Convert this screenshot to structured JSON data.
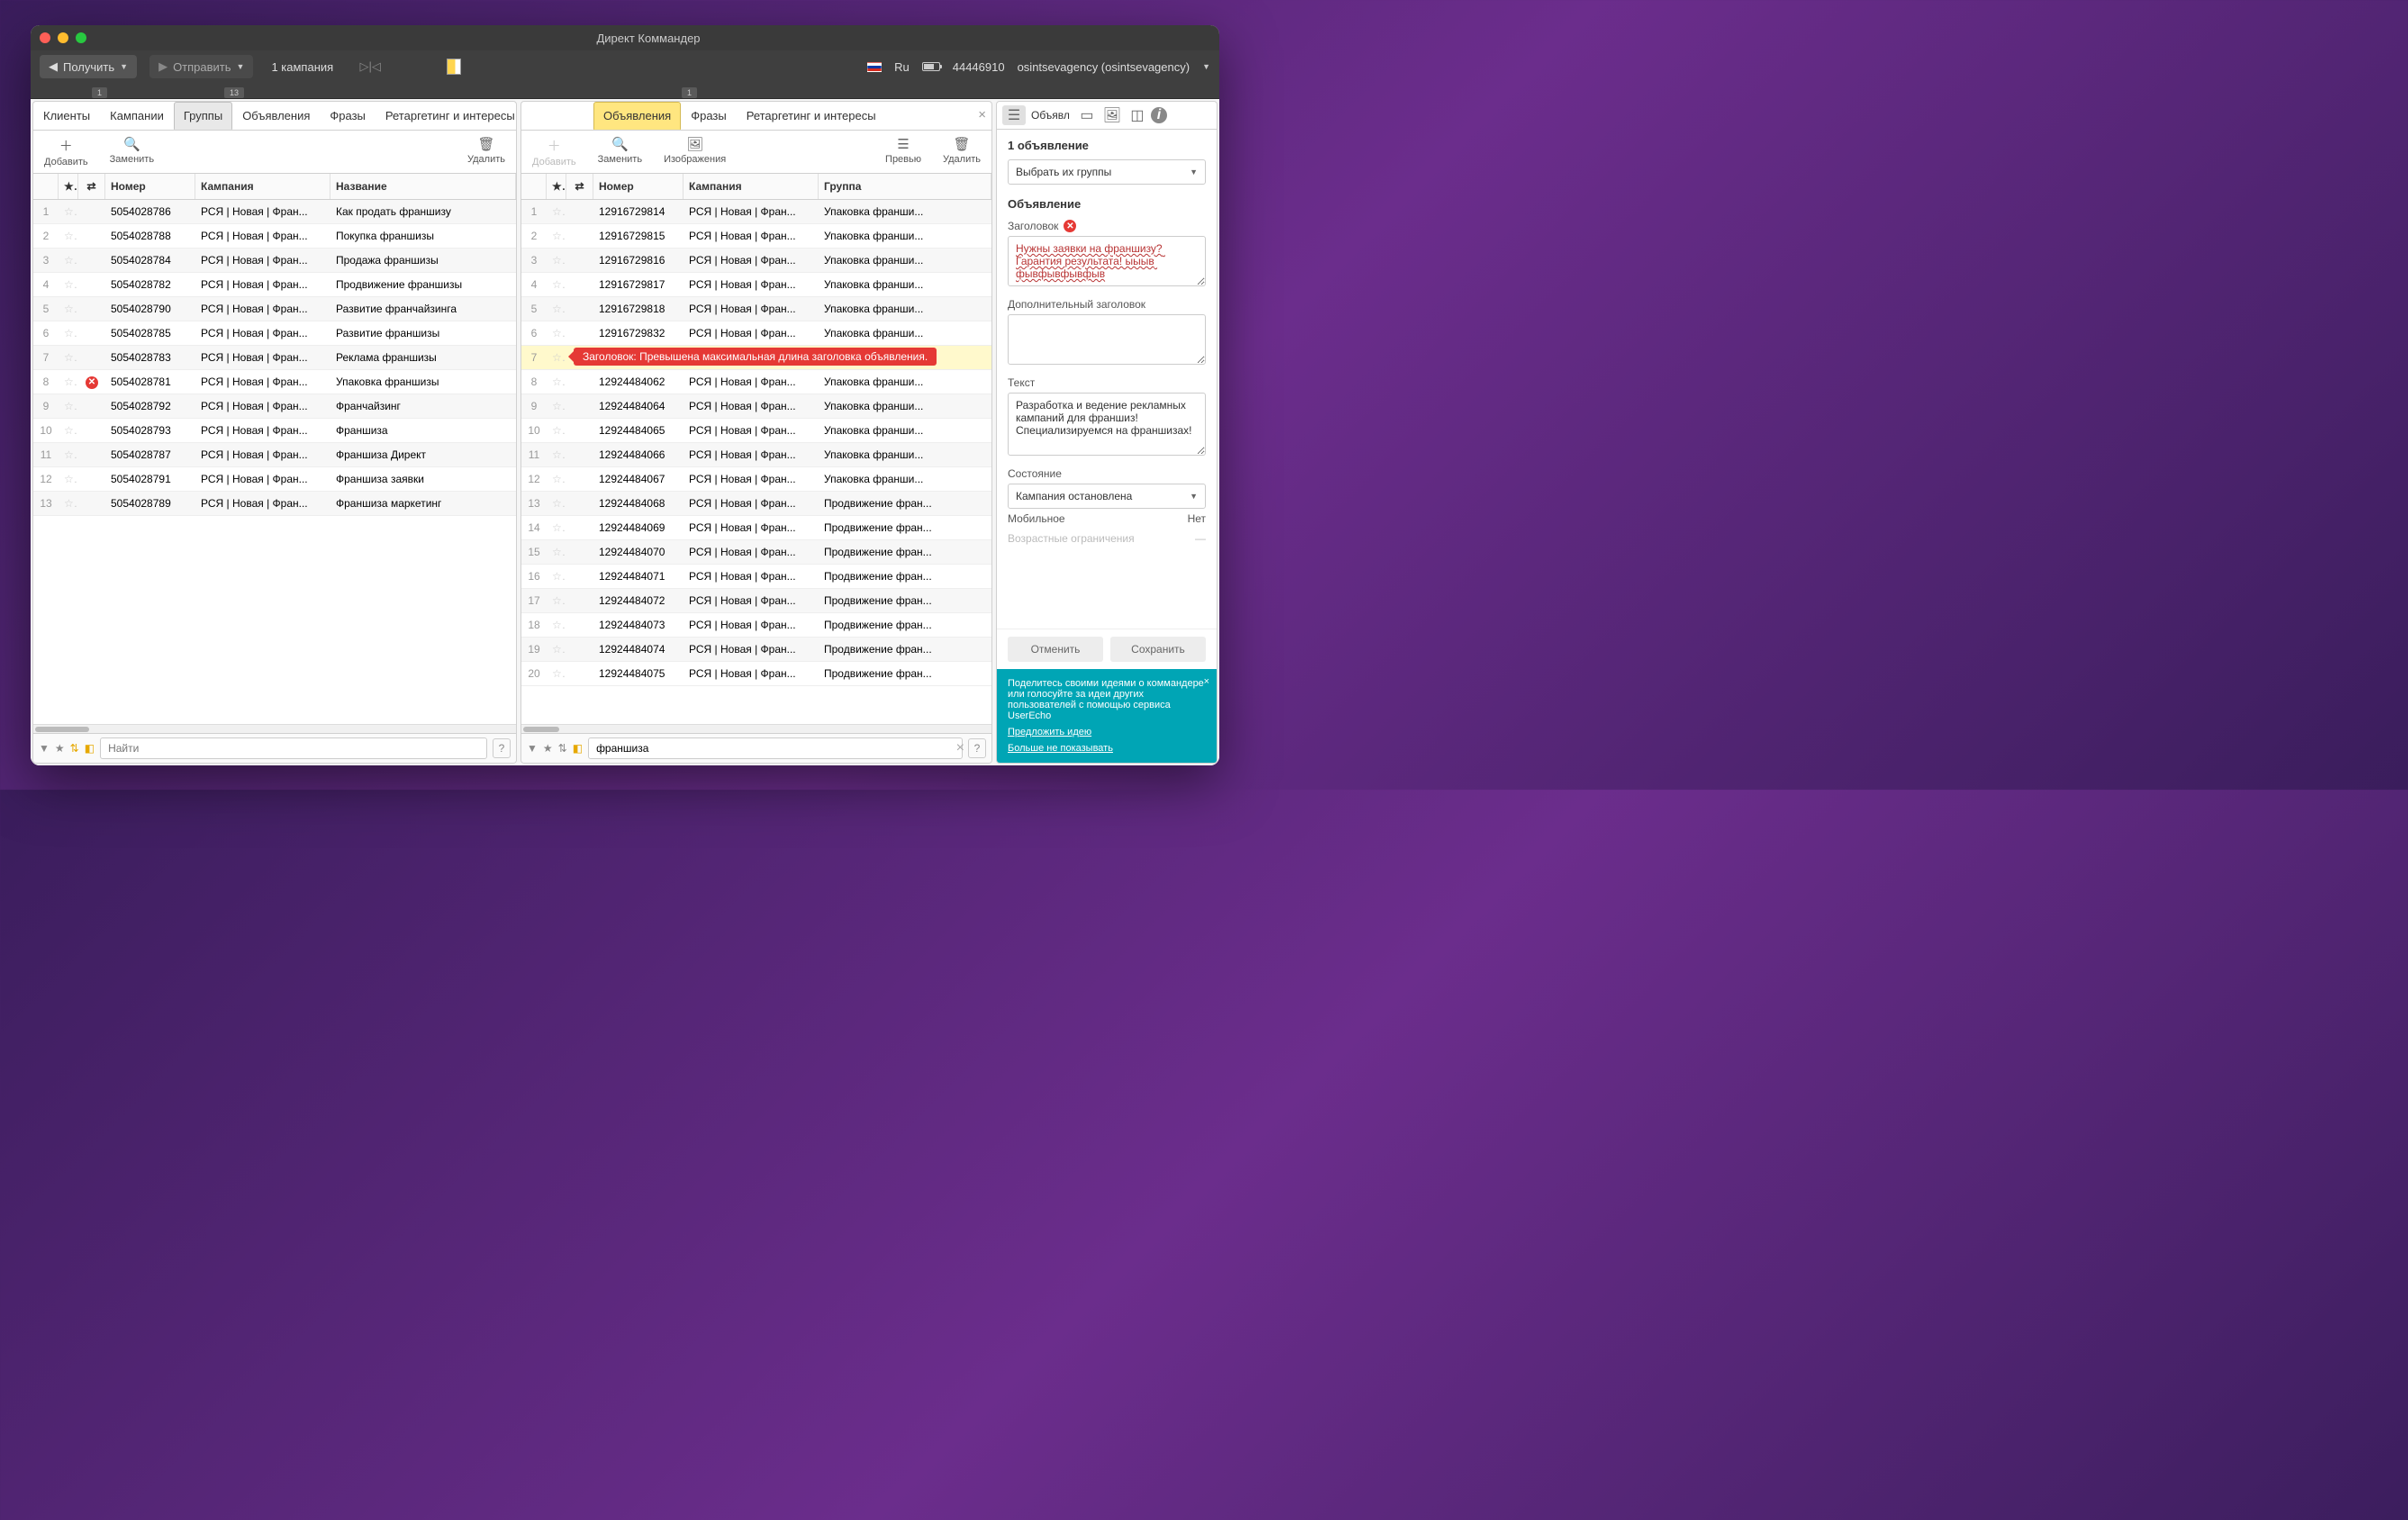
{
  "window": {
    "title": "Директ Коммандер"
  },
  "toolbar": {
    "get_label": "Получить",
    "send_label": "Отправить",
    "campaign_count": "1 кампания",
    "lang": "Ru",
    "account_id": "44446910",
    "user": "osintsevagency (osintsevagency)"
  },
  "badges": {
    "b1": "1",
    "b2": "13",
    "b3": "1"
  },
  "left": {
    "tabs": [
      "Клиенты",
      "Кампании",
      "Группы",
      "Объявления",
      "Фразы",
      "Ретаргетинг и интересы"
    ],
    "active_idx": 2,
    "actions": {
      "add": "Добавить",
      "replace": "Заменить",
      "delete": "Удалить"
    },
    "columns": {
      "num": "Номер",
      "camp": "Кампания",
      "name": "Название"
    },
    "rows": [
      {
        "n": "1",
        "id": "5054028786",
        "camp": "РСЯ | Новая | Фран...",
        "name": "Как продать франшизу",
        "err": false
      },
      {
        "n": "2",
        "id": "5054028788",
        "camp": "РСЯ | Новая | Фран...",
        "name": "Покупка франшизы",
        "err": false
      },
      {
        "n": "3",
        "id": "5054028784",
        "camp": "РСЯ | Новая | Фран...",
        "name": "Продажа франшизы",
        "err": false
      },
      {
        "n": "4",
        "id": "5054028782",
        "camp": "РСЯ | Новая | Фран...",
        "name": "Продвижение франшизы",
        "err": false
      },
      {
        "n": "5",
        "id": "5054028790",
        "camp": "РСЯ | Новая | Фран...",
        "name": "Развитие франчайзинга",
        "err": false
      },
      {
        "n": "6",
        "id": "5054028785",
        "camp": "РСЯ | Новая | Фран...",
        "name": "Развитие франшизы",
        "err": false
      },
      {
        "n": "7",
        "id": "5054028783",
        "camp": "РСЯ | Новая | Фран...",
        "name": "Реклама франшизы",
        "err": false
      },
      {
        "n": "8",
        "id": "5054028781",
        "camp": "РСЯ | Новая | Фран...",
        "name": "Упаковка франшизы",
        "err": true
      },
      {
        "n": "9",
        "id": "5054028792",
        "camp": "РСЯ | Новая | Фран...",
        "name": "Франчайзинг",
        "err": false
      },
      {
        "n": "10",
        "id": "5054028793",
        "camp": "РСЯ | Новая | Фран...",
        "name": "Франшиза",
        "err": false
      },
      {
        "n": "11",
        "id": "5054028787",
        "camp": "РСЯ | Новая | Фран...",
        "name": "Франшиза Директ",
        "err": false
      },
      {
        "n": "12",
        "id": "5054028791",
        "camp": "РСЯ | Новая | Фран...",
        "name": "Франшиза заявки",
        "err": false
      },
      {
        "n": "13",
        "id": "5054028789",
        "camp": "РСЯ | Новая | Фран...",
        "name": "Франшиза маркетинг",
        "err": false
      }
    ],
    "search_placeholder": "Найти"
  },
  "mid": {
    "tabs": [
      "Объявления",
      "Фразы",
      "Ретаргетинг и интересы"
    ],
    "active_idx": 0,
    "actions": {
      "add": "Добавить",
      "replace": "Заменить",
      "images": "Изображения",
      "preview": "Превью",
      "delete": "Удалить"
    },
    "columns": {
      "num": "Номер",
      "camp": "Кампания",
      "group": "Группа"
    },
    "rows": [
      {
        "n": "1",
        "id": "12916729814",
        "camp": "РСЯ | Новая | Фран...",
        "group": "Упаковка франши..."
      },
      {
        "n": "2",
        "id": "12916729815",
        "camp": "РСЯ | Новая | Фран...",
        "group": "Упаковка франши..."
      },
      {
        "n": "3",
        "id": "12916729816",
        "camp": "РСЯ | Новая | Фран...",
        "group": "Упаковка франши..."
      },
      {
        "n": "4",
        "id": "12916729817",
        "camp": "РСЯ | Новая | Фран...",
        "group": "Упаковка франши..."
      },
      {
        "n": "5",
        "id": "12916729818",
        "camp": "РСЯ | Новая | Фран...",
        "group": "Упаковка франши..."
      },
      {
        "n": "6",
        "id": "12916729832",
        "camp": "РСЯ | Новая | Фран...",
        "group": "Упаковка франши..."
      },
      {
        "n": "7",
        "id": "",
        "camp": "",
        "group": "",
        "err": true,
        "msg": "Заголовок: Превышена максимальная длина заголовка объявления."
      },
      {
        "n": "8",
        "id": "12924484062",
        "camp": "РСЯ | Новая | Фран...",
        "group": "Упаковка франши..."
      },
      {
        "n": "9",
        "id": "12924484064",
        "camp": "РСЯ | Новая | Фран...",
        "group": "Упаковка франши..."
      },
      {
        "n": "10",
        "id": "12924484065",
        "camp": "РСЯ | Новая | Фран...",
        "group": "Упаковка франши..."
      },
      {
        "n": "11",
        "id": "12924484066",
        "camp": "РСЯ | Новая | Фран...",
        "group": "Упаковка франши..."
      },
      {
        "n": "12",
        "id": "12924484067",
        "camp": "РСЯ | Новая | Фран...",
        "group": "Упаковка франши..."
      },
      {
        "n": "13",
        "id": "12924484068",
        "camp": "РСЯ | Новая | Фран...",
        "group": "Продвижение фран..."
      },
      {
        "n": "14",
        "id": "12924484069",
        "camp": "РСЯ | Новая | Фран...",
        "group": "Продвижение фран..."
      },
      {
        "n": "15",
        "id": "12924484070",
        "camp": "РСЯ | Новая | Фран...",
        "group": "Продвижение фран..."
      },
      {
        "n": "16",
        "id": "12924484071",
        "camp": "РСЯ | Новая | Фран...",
        "group": "Продвижение фран..."
      },
      {
        "n": "17",
        "id": "12924484072",
        "camp": "РСЯ | Новая | Фран...",
        "group": "Продвижение фран..."
      },
      {
        "n": "18",
        "id": "12924484073",
        "camp": "РСЯ | Новая | Фран...",
        "group": "Продвижение фран..."
      },
      {
        "n": "19",
        "id": "12924484074",
        "camp": "РСЯ | Новая | Фран...",
        "group": "Продвижение фран..."
      },
      {
        "n": "20",
        "id": "12924484075",
        "camp": "РСЯ | Новая | Фран...",
        "group": "Продвижение фран..."
      }
    ],
    "search_value": "франшиза"
  },
  "right": {
    "tab_prefix": "Объявл",
    "heading": "1 объявление",
    "select_groups": "Выбрать их группы",
    "section": "Объявление",
    "label_headline": "Заголовок",
    "headline_value": "Нужны заявки на франшизу? Гарантия результата! ыыыв фывфывфывфыв",
    "label_headline2": "Дополнительный заголовок",
    "headline2_value": "",
    "label_text": "Текст",
    "text_value": "Разработка и ведение рекламных кампаний для франшиз! Специализируемся на франшизах!",
    "label_state": "Состояние",
    "state_value": "Кампания остановлена",
    "label_mobile": "Мобильное",
    "mobile_value": "Нет",
    "label_age": "Возрастные ограничения",
    "age_value": "—",
    "cancel": "Отменить",
    "save": "Сохранить",
    "promo_text": "Поделитесь своими идеями о коммандере или голосуйте за идеи других пользователей с помощью сервиса UserEcho",
    "promo_link1": "Предложить идею",
    "promo_link2": "Больше не показывать"
  }
}
